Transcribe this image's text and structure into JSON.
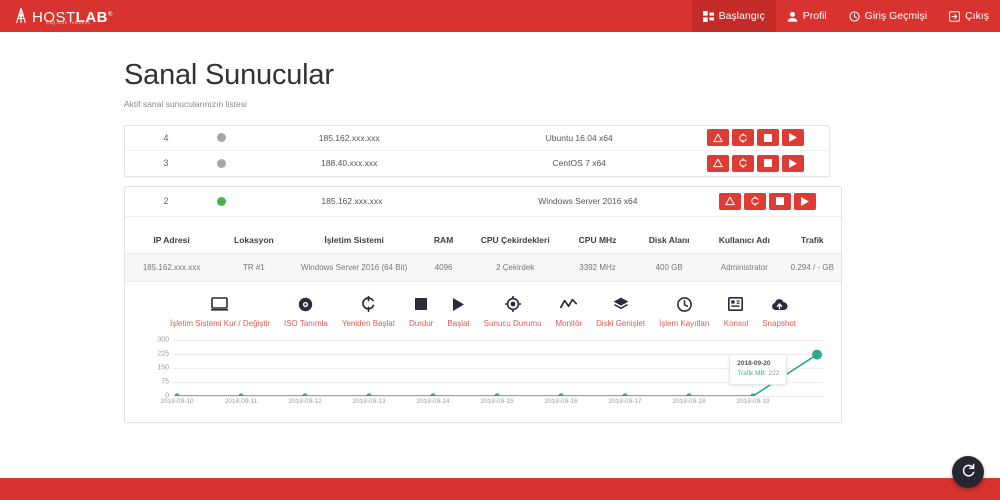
{
  "header": {
    "brand": {
      "name_light": "HOST",
      "name_bold": "LAB",
      "reg": "®",
      "tagline": "Çağ Atan Teknoloji"
    },
    "nav": [
      {
        "label": "Başlangıç",
        "icon": "grid-icon",
        "active": true
      },
      {
        "label": "Profil",
        "icon": "user-icon",
        "active": false
      },
      {
        "label": "Giriş Geçmişi",
        "icon": "history-clock-icon",
        "active": false
      },
      {
        "label": "Çıkış",
        "icon": "logout-icon",
        "active": false
      }
    ]
  },
  "page": {
    "title": "Sanal Sunucular",
    "subtitle": "Aktif sanal sunucularınızın listesi"
  },
  "servers": [
    {
      "id": "4",
      "status": "offline",
      "ip": "185.162.xxx.xxx",
      "os": "Ubuntu 16.04 x64"
    },
    {
      "id": "3",
      "status": "offline",
      "ip": "188.40.xxx.xxx",
      "os": "CentOS 7 x64"
    }
  ],
  "expanded_server": {
    "id": "2",
    "status": "online",
    "ip": "185.162.xxx.xxx",
    "os": "Windows Server 2016 x64"
  },
  "row_actions": [
    {
      "name": "warning-triangle-icon",
      "label": "Uyarı"
    },
    {
      "name": "refresh-icon",
      "label": "Yenile"
    },
    {
      "name": "stop-square-icon",
      "label": "Durdur"
    },
    {
      "name": "play-icon",
      "label": "Başlat"
    }
  ],
  "detail_table": {
    "headers": [
      "IP Adresi",
      "Lokasyon",
      "İşletim Sistemi",
      "RAM",
      "CPU Çekirdekleri",
      "CPU MHz",
      "Disk Alanı",
      "Kullanıcı Adı",
      "Trafik"
    ],
    "values": [
      "185.162.xxx.xxx",
      "TR #1",
      "Windows Server 2016 (64 Bit)",
      "4096",
      "2 Çekirdek",
      "3392 MHz",
      "400 GB",
      "Administrator",
      "0.294 / - GB"
    ]
  },
  "detail_actions": [
    {
      "label": "İşletim Sistemi Kur / Değiştir",
      "icon": "monitor-icon"
    },
    {
      "label": "ISO Tanımla",
      "icon": "disc-icon"
    },
    {
      "label": "Yeniden Başlat",
      "icon": "restart-icon"
    },
    {
      "label": "Durdur",
      "icon": "stop-square-icon"
    },
    {
      "label": "Başlat",
      "icon": "play-icon"
    },
    {
      "label": "Sunucu Durumu",
      "icon": "target-icon"
    },
    {
      "label": "Monitör",
      "icon": "activity-line-icon"
    },
    {
      "label": "Diski Genişlet",
      "icon": "layers-icon"
    },
    {
      "label": "İşlem Kayıtları",
      "icon": "history-clock-icon"
    },
    {
      "label": "Konsol",
      "icon": "console-icon"
    },
    {
      "label": "Snapshot",
      "icon": "cloud-upload-icon"
    }
  ],
  "chart_data": {
    "type": "line",
    "title": "",
    "xlabel": "",
    "ylabel": "",
    "ylim": [
      0,
      300
    ],
    "yticks": [
      0,
      75,
      150,
      225,
      300
    ],
    "grid": true,
    "legend": "none",
    "series_name": "Trafik MB",
    "line_color": "#2fa88a",
    "categories": [
      "2018-09-10",
      "2018-09-11",
      "2018-09-12",
      "2018-09-13",
      "2018-09-14",
      "2018-09-15",
      "2018-09-16",
      "2018-09-17",
      "2018-09-18",
      "2018-09-19",
      "2018-09-20"
    ],
    "values": [
      0,
      0,
      0,
      0,
      0,
      0,
      0,
      0,
      0,
      0,
      222
    ],
    "visible_xticks": [
      "2018-09-10",
      "2018-09-11",
      "2018-09-12",
      "2018-09-13",
      "2018-09-14",
      "2018-09-15",
      "2018-09-16",
      "2018-09-17",
      "2018-09-18",
      "2018-09-19"
    ],
    "tooltip": {
      "date": "2018-09-20",
      "label": "Trafik MB",
      "value": "222"
    }
  },
  "fab": {
    "icon": "reload-icon",
    "label": "Yenile"
  },
  "colors": {
    "brand_red": "#d8332f",
    "button_red": "#dd3b33",
    "action_label": "#e05a52",
    "status_online": "#4caf50",
    "status_offline": "#a6a6a6",
    "chart_line": "#2fa88a"
  }
}
